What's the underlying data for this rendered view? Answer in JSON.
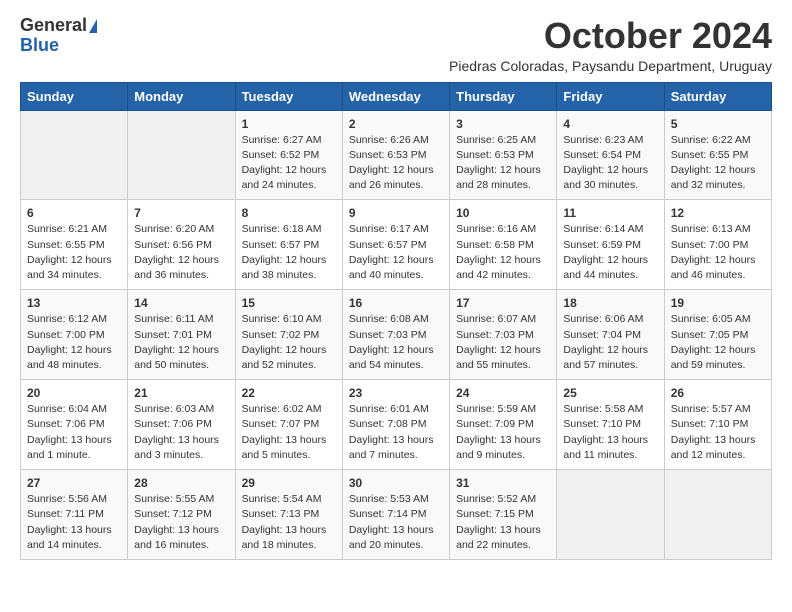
{
  "logo": {
    "general": "General",
    "blue": "Blue"
  },
  "title": "October 2024",
  "subtitle": "Piedras Coloradas, Paysandu Department, Uruguay",
  "days_header": [
    "Sunday",
    "Monday",
    "Tuesday",
    "Wednesday",
    "Thursday",
    "Friday",
    "Saturday"
  ],
  "weeks": [
    [
      {
        "day": "",
        "info": ""
      },
      {
        "day": "",
        "info": ""
      },
      {
        "day": "1",
        "info": "Sunrise: 6:27 AM\nSunset: 6:52 PM\nDaylight: 12 hours and 24 minutes."
      },
      {
        "day": "2",
        "info": "Sunrise: 6:26 AM\nSunset: 6:53 PM\nDaylight: 12 hours and 26 minutes."
      },
      {
        "day": "3",
        "info": "Sunrise: 6:25 AM\nSunset: 6:53 PM\nDaylight: 12 hours and 28 minutes."
      },
      {
        "day": "4",
        "info": "Sunrise: 6:23 AM\nSunset: 6:54 PM\nDaylight: 12 hours and 30 minutes."
      },
      {
        "day": "5",
        "info": "Sunrise: 6:22 AM\nSunset: 6:55 PM\nDaylight: 12 hours and 32 minutes."
      }
    ],
    [
      {
        "day": "6",
        "info": "Sunrise: 6:21 AM\nSunset: 6:55 PM\nDaylight: 12 hours and 34 minutes."
      },
      {
        "day": "7",
        "info": "Sunrise: 6:20 AM\nSunset: 6:56 PM\nDaylight: 12 hours and 36 minutes."
      },
      {
        "day": "8",
        "info": "Sunrise: 6:18 AM\nSunset: 6:57 PM\nDaylight: 12 hours and 38 minutes."
      },
      {
        "day": "9",
        "info": "Sunrise: 6:17 AM\nSunset: 6:57 PM\nDaylight: 12 hours and 40 minutes."
      },
      {
        "day": "10",
        "info": "Sunrise: 6:16 AM\nSunset: 6:58 PM\nDaylight: 12 hours and 42 minutes."
      },
      {
        "day": "11",
        "info": "Sunrise: 6:14 AM\nSunset: 6:59 PM\nDaylight: 12 hours and 44 minutes."
      },
      {
        "day": "12",
        "info": "Sunrise: 6:13 AM\nSunset: 7:00 PM\nDaylight: 12 hours and 46 minutes."
      }
    ],
    [
      {
        "day": "13",
        "info": "Sunrise: 6:12 AM\nSunset: 7:00 PM\nDaylight: 12 hours and 48 minutes."
      },
      {
        "day": "14",
        "info": "Sunrise: 6:11 AM\nSunset: 7:01 PM\nDaylight: 12 hours and 50 minutes."
      },
      {
        "day": "15",
        "info": "Sunrise: 6:10 AM\nSunset: 7:02 PM\nDaylight: 12 hours and 52 minutes."
      },
      {
        "day": "16",
        "info": "Sunrise: 6:08 AM\nSunset: 7:03 PM\nDaylight: 12 hours and 54 minutes."
      },
      {
        "day": "17",
        "info": "Sunrise: 6:07 AM\nSunset: 7:03 PM\nDaylight: 12 hours and 55 minutes."
      },
      {
        "day": "18",
        "info": "Sunrise: 6:06 AM\nSunset: 7:04 PM\nDaylight: 12 hours and 57 minutes."
      },
      {
        "day": "19",
        "info": "Sunrise: 6:05 AM\nSunset: 7:05 PM\nDaylight: 12 hours and 59 minutes."
      }
    ],
    [
      {
        "day": "20",
        "info": "Sunrise: 6:04 AM\nSunset: 7:06 PM\nDaylight: 13 hours and 1 minute."
      },
      {
        "day": "21",
        "info": "Sunrise: 6:03 AM\nSunset: 7:06 PM\nDaylight: 13 hours and 3 minutes."
      },
      {
        "day": "22",
        "info": "Sunrise: 6:02 AM\nSunset: 7:07 PM\nDaylight: 13 hours and 5 minutes."
      },
      {
        "day": "23",
        "info": "Sunrise: 6:01 AM\nSunset: 7:08 PM\nDaylight: 13 hours and 7 minutes."
      },
      {
        "day": "24",
        "info": "Sunrise: 5:59 AM\nSunset: 7:09 PM\nDaylight: 13 hours and 9 minutes."
      },
      {
        "day": "25",
        "info": "Sunrise: 5:58 AM\nSunset: 7:10 PM\nDaylight: 13 hours and 11 minutes."
      },
      {
        "day": "26",
        "info": "Sunrise: 5:57 AM\nSunset: 7:10 PM\nDaylight: 13 hours and 12 minutes."
      }
    ],
    [
      {
        "day": "27",
        "info": "Sunrise: 5:56 AM\nSunset: 7:11 PM\nDaylight: 13 hours and 14 minutes."
      },
      {
        "day": "28",
        "info": "Sunrise: 5:55 AM\nSunset: 7:12 PM\nDaylight: 13 hours and 16 minutes."
      },
      {
        "day": "29",
        "info": "Sunrise: 5:54 AM\nSunset: 7:13 PM\nDaylight: 13 hours and 18 minutes."
      },
      {
        "day": "30",
        "info": "Sunrise: 5:53 AM\nSunset: 7:14 PM\nDaylight: 13 hours and 20 minutes."
      },
      {
        "day": "31",
        "info": "Sunrise: 5:52 AM\nSunset: 7:15 PM\nDaylight: 13 hours and 22 minutes."
      },
      {
        "day": "",
        "info": ""
      },
      {
        "day": "",
        "info": ""
      }
    ]
  ]
}
